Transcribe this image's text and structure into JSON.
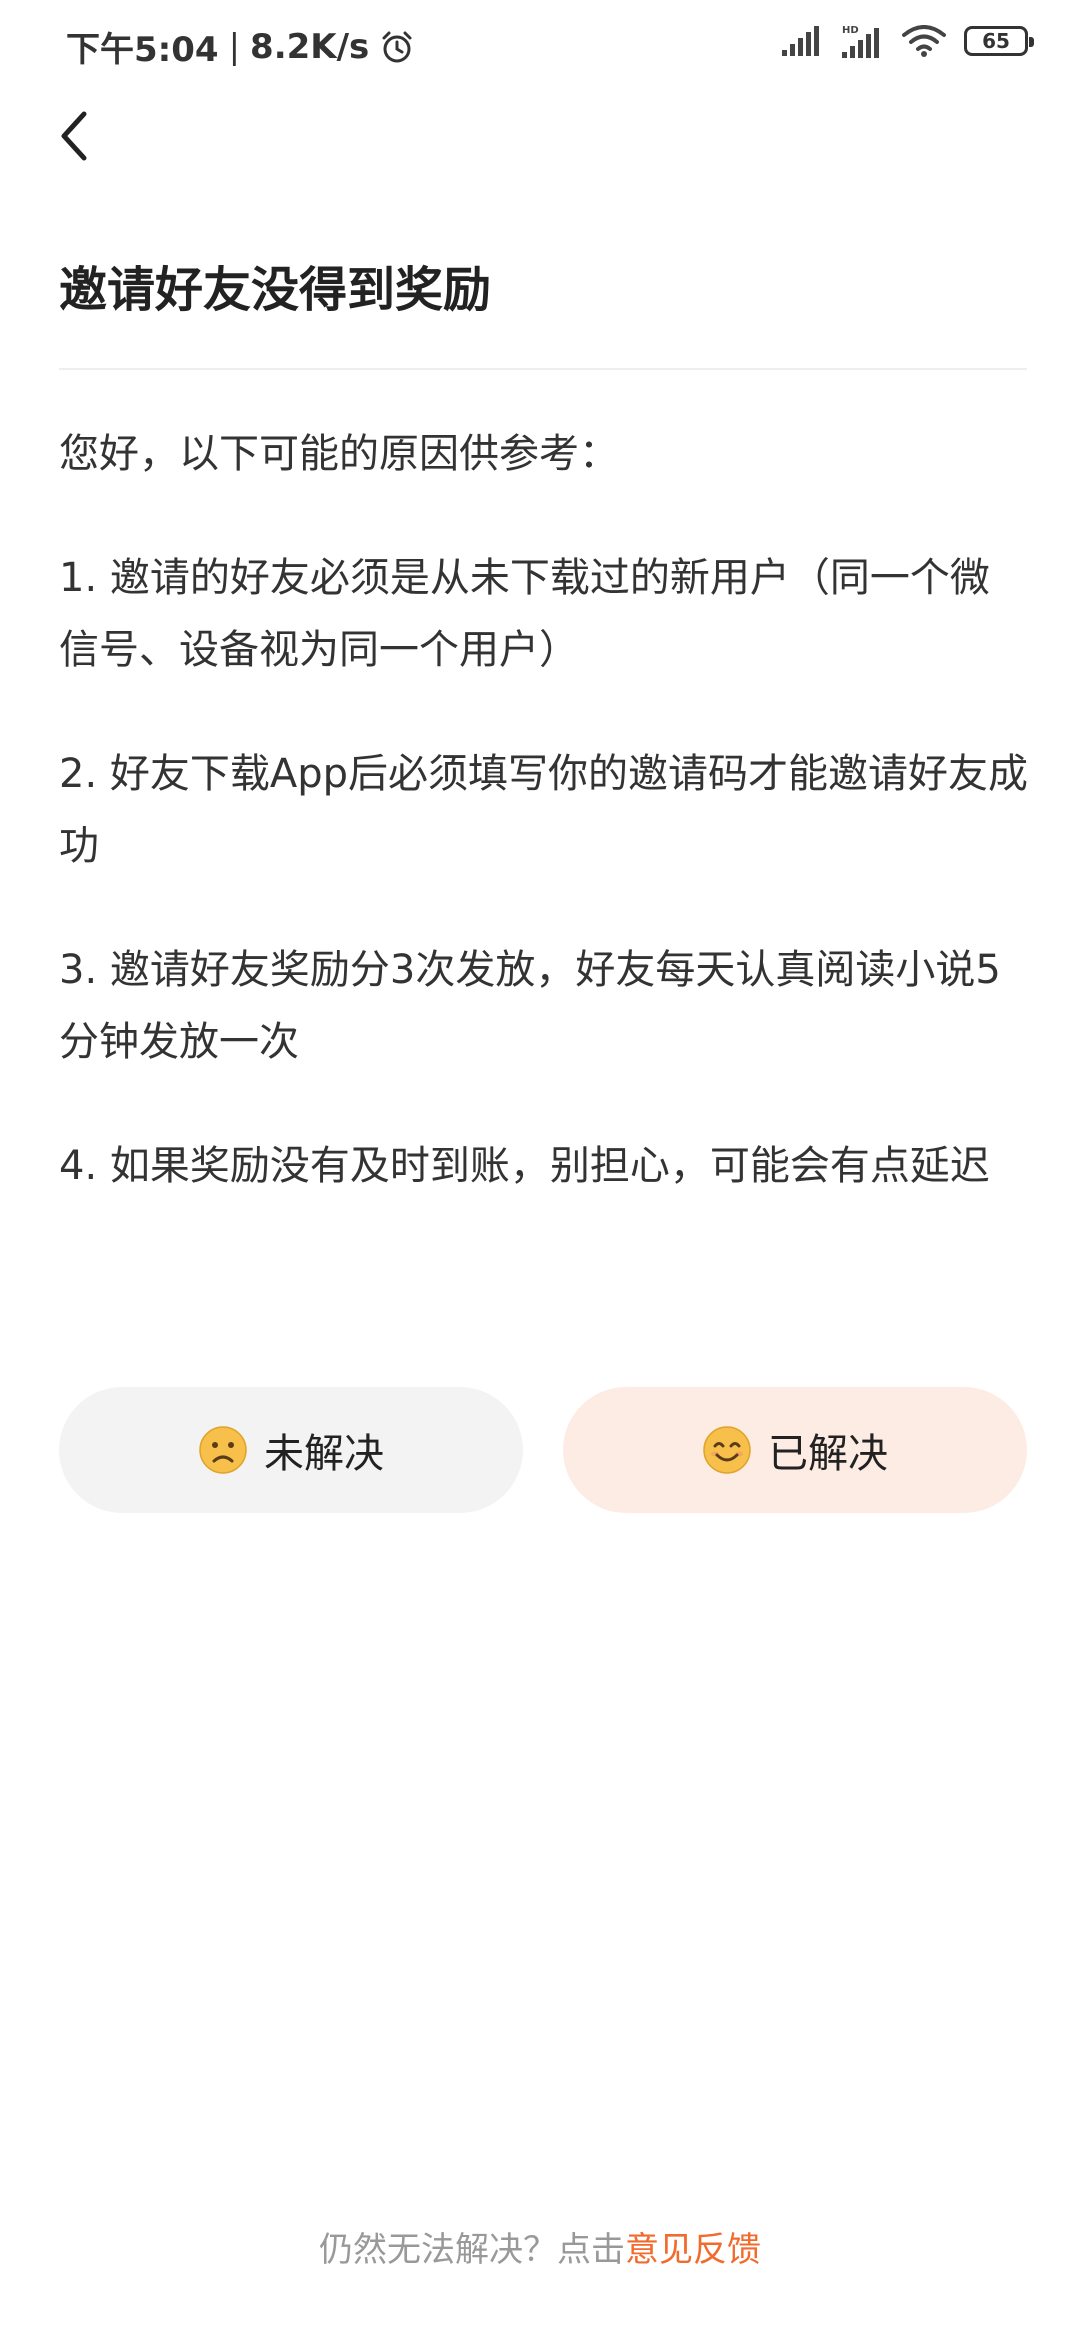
{
  "status_bar": {
    "time": "下午5:04",
    "separator": "|",
    "net_speed": "8.2K/s",
    "battery": "65",
    "icons": [
      "alarm-icon",
      "signal-icon",
      "hd-signal-icon",
      "wifi-icon",
      "battery-icon"
    ]
  },
  "nav": {
    "back_icon": "chevron-left-icon"
  },
  "article": {
    "title": "邀请好友没得到奖励",
    "intro": "您好，以下可能的原因供参考：",
    "points": [
      "1. 邀请的好友必须是从未下载过的新用户（同一个微信号、设备视为同一个用户）",
      "2. 好友下载App后必须填写你的邀请码才能邀请好友成功",
      "3. 邀请好友奖励分3次发放，好友每天认真阅读小说5分钟发放一次",
      "4. 如果奖励没有及时到账，别担心，可能会有点延迟"
    ]
  },
  "feedback": {
    "unresolved_label": "未解决",
    "unresolved_icon": "frown-face-icon",
    "resolved_label": "已解决",
    "resolved_icon": "smile-face-icon",
    "unresolved_bg": "#f3f3f3",
    "resolved_bg": "#fdece4"
  },
  "footer": {
    "prompt": "仍然无法解决？点击",
    "link_label": "意见反馈",
    "link_color": "#f26a2c"
  }
}
